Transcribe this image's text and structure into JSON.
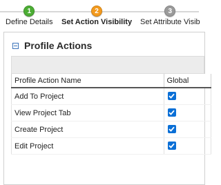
{
  "wizard": {
    "steps": [
      {
        "number": "1",
        "label": "Define Details",
        "color": "#4cad34",
        "state": "done"
      },
      {
        "number": "2",
        "label": "Set Action Visibility",
        "color": "#f39a1e",
        "state": "active"
      },
      {
        "number": "3",
        "label": "Set Attribute Visib",
        "color": "#9b9b9b",
        "state": "pending"
      }
    ]
  },
  "panel": {
    "title": "Profile Actions",
    "columns": {
      "name": "Profile Action Name",
      "global": "Global"
    },
    "rows": [
      {
        "name": "Add To Project",
        "global": true
      },
      {
        "name": "View Project Tab",
        "global": true
      },
      {
        "name": "Create Project",
        "global": true
      },
      {
        "name": "Edit Project",
        "global": true
      }
    ]
  },
  "colors": {
    "accent": "#0a6fd6",
    "done": "#4cad34",
    "active": "#f39a1e",
    "pending": "#9b9b9b"
  }
}
